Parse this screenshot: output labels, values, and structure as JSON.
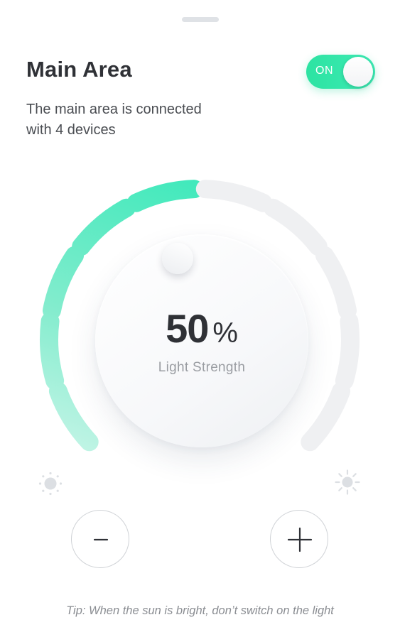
{
  "header": {
    "title": "Main Area",
    "subtitle_line1": "The main area is connected",
    "subtitle_line2": "with 4 devices"
  },
  "power_toggle": {
    "label": "ON",
    "state": "on"
  },
  "dial": {
    "value": "50",
    "unit": "%",
    "label": "Light Strength",
    "level_fraction": 0.5,
    "total_segments": 10,
    "active_color_start": "#8ee9cf",
    "active_color_end": "#3fe9bb",
    "inactive_color": "#eff0f2"
  },
  "controls": {
    "decrease_icon": "minus-icon",
    "increase_icon": "plus-icon",
    "low_icon": "sun-dim-icon",
    "high_icon": "sun-bright-icon"
  },
  "tip": "Tip: When the sun is bright, don’t switch on the light"
}
